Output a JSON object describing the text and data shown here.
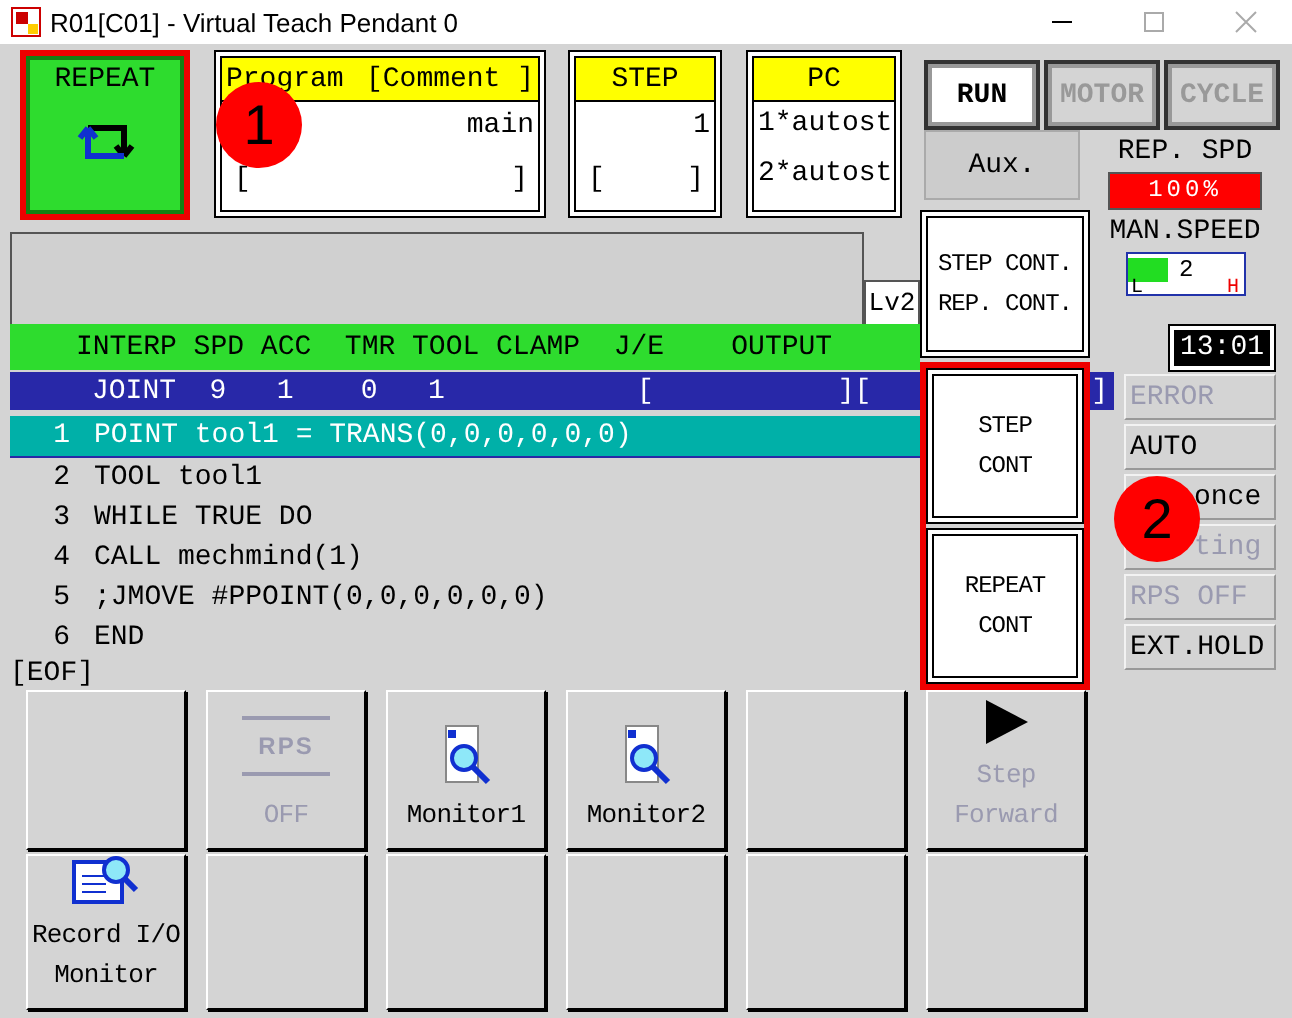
{
  "window": {
    "title": "R01[C01] - Virtual Teach Pendant 0"
  },
  "mode_button": {
    "label": "REPEAT",
    "selected": true
  },
  "program_panel": {
    "header": "Program",
    "comment": "[Comment ]",
    "value": "main",
    "open": "[",
    "close": "]"
  },
  "step_panel": {
    "header": "STEP",
    "value": "1",
    "open": "[",
    "close": "]"
  },
  "pc_panel": {
    "header": "PC",
    "lines": [
      "1*autost",
      "2*autost"
    ]
  },
  "status_buttons": [
    {
      "label": "RUN",
      "active": true
    },
    {
      "label": "MOTOR",
      "active": false
    },
    {
      "label": "CYCLE",
      "active": false
    }
  ],
  "aux_button": {
    "label": "Aux."
  },
  "rep_speed": {
    "label": "REP. SPD",
    "reading": "100%",
    "level": 1
  },
  "man_speed": {
    "label": "MAN.SPEED",
    "reading": "2",
    "level": 0.35,
    "low": "L",
    "high": "H"
  },
  "level_tag": "Lv2",
  "clock": "13:01",
  "columns_header": "INTERP SPD ACC  TMR TOOL CLAMP  J/E    OUTPUT",
  "joint_row": {
    "text": "JOINT  9   1    0   1",
    "brackets": [
      "[",
      "][",
      "]"
    ]
  },
  "program_lines": [
    {
      "number": "1",
      "code": "POINT tool1 = TRANS(0,0,0,0,0,0)",
      "selected": true
    },
    {
      "number": "2",
      "code": "TOOL tool1",
      "selected": false
    },
    {
      "number": "3",
      "code": "WHILE TRUE DO",
      "selected": false
    },
    {
      "number": "4",
      "code": "CALL mechmind(1)",
      "selected": false
    },
    {
      "number": "5",
      "code": ";JMOVE #PPOINT(0,0,0,0,0,0)",
      "selected": false
    },
    {
      "number": "6",
      "code": "END",
      "selected": false
    }
  ],
  "eof": "[EOF]",
  "indicators": [
    {
      "label": "ERROR",
      "active": false,
      "covered": false
    },
    {
      "label": "AUTO",
      "active": true,
      "covered": false
    },
    {
      "label": "once",
      "active": true,
      "covered": true
    },
    {
      "label": "ting",
      "active": false,
      "covered": true
    },
    {
      "label": "RPS OFF",
      "active": false,
      "covered": false
    },
    {
      "label": "EXT.HOLD",
      "active": true,
      "covered": false
    }
  ],
  "popup_menu": [
    {
      "lines": [
        "STEP CONT.",
        "REP. CONT."
      ],
      "highlighted": false
    },
    {
      "lines": [
        "STEP",
        "CONT"
      ],
      "highlighted": true
    },
    {
      "lines": [
        "REPEAT",
        "CONT"
      ],
      "highlighted": true
    }
  ],
  "function_keys": [
    {
      "kind": "blank"
    },
    {
      "kind": "rps",
      "icon_text": "RPS",
      "lines": [
        "OFF"
      ],
      "disabled": true
    },
    {
      "kind": "monitor",
      "lines": [
        "Monitor1"
      ],
      "disabled": false
    },
    {
      "kind": "monitor",
      "lines": [
        "Monitor2"
      ],
      "disabled": false
    },
    {
      "kind": "blank"
    },
    {
      "kind": "play",
      "lines": [
        "Step",
        "Forward"
      ],
      "disabled": true
    },
    {
      "kind": "record",
      "lines": [
        "Record I/O",
        "Monitor"
      ],
      "disabled": false
    },
    {
      "kind": "blank"
    },
    {
      "kind": "blank"
    },
    {
      "kind": "blank"
    },
    {
      "kind": "blank"
    },
    {
      "kind": "blank"
    }
  ],
  "callouts": [
    {
      "text": "1"
    },
    {
      "text": "2"
    }
  ]
}
